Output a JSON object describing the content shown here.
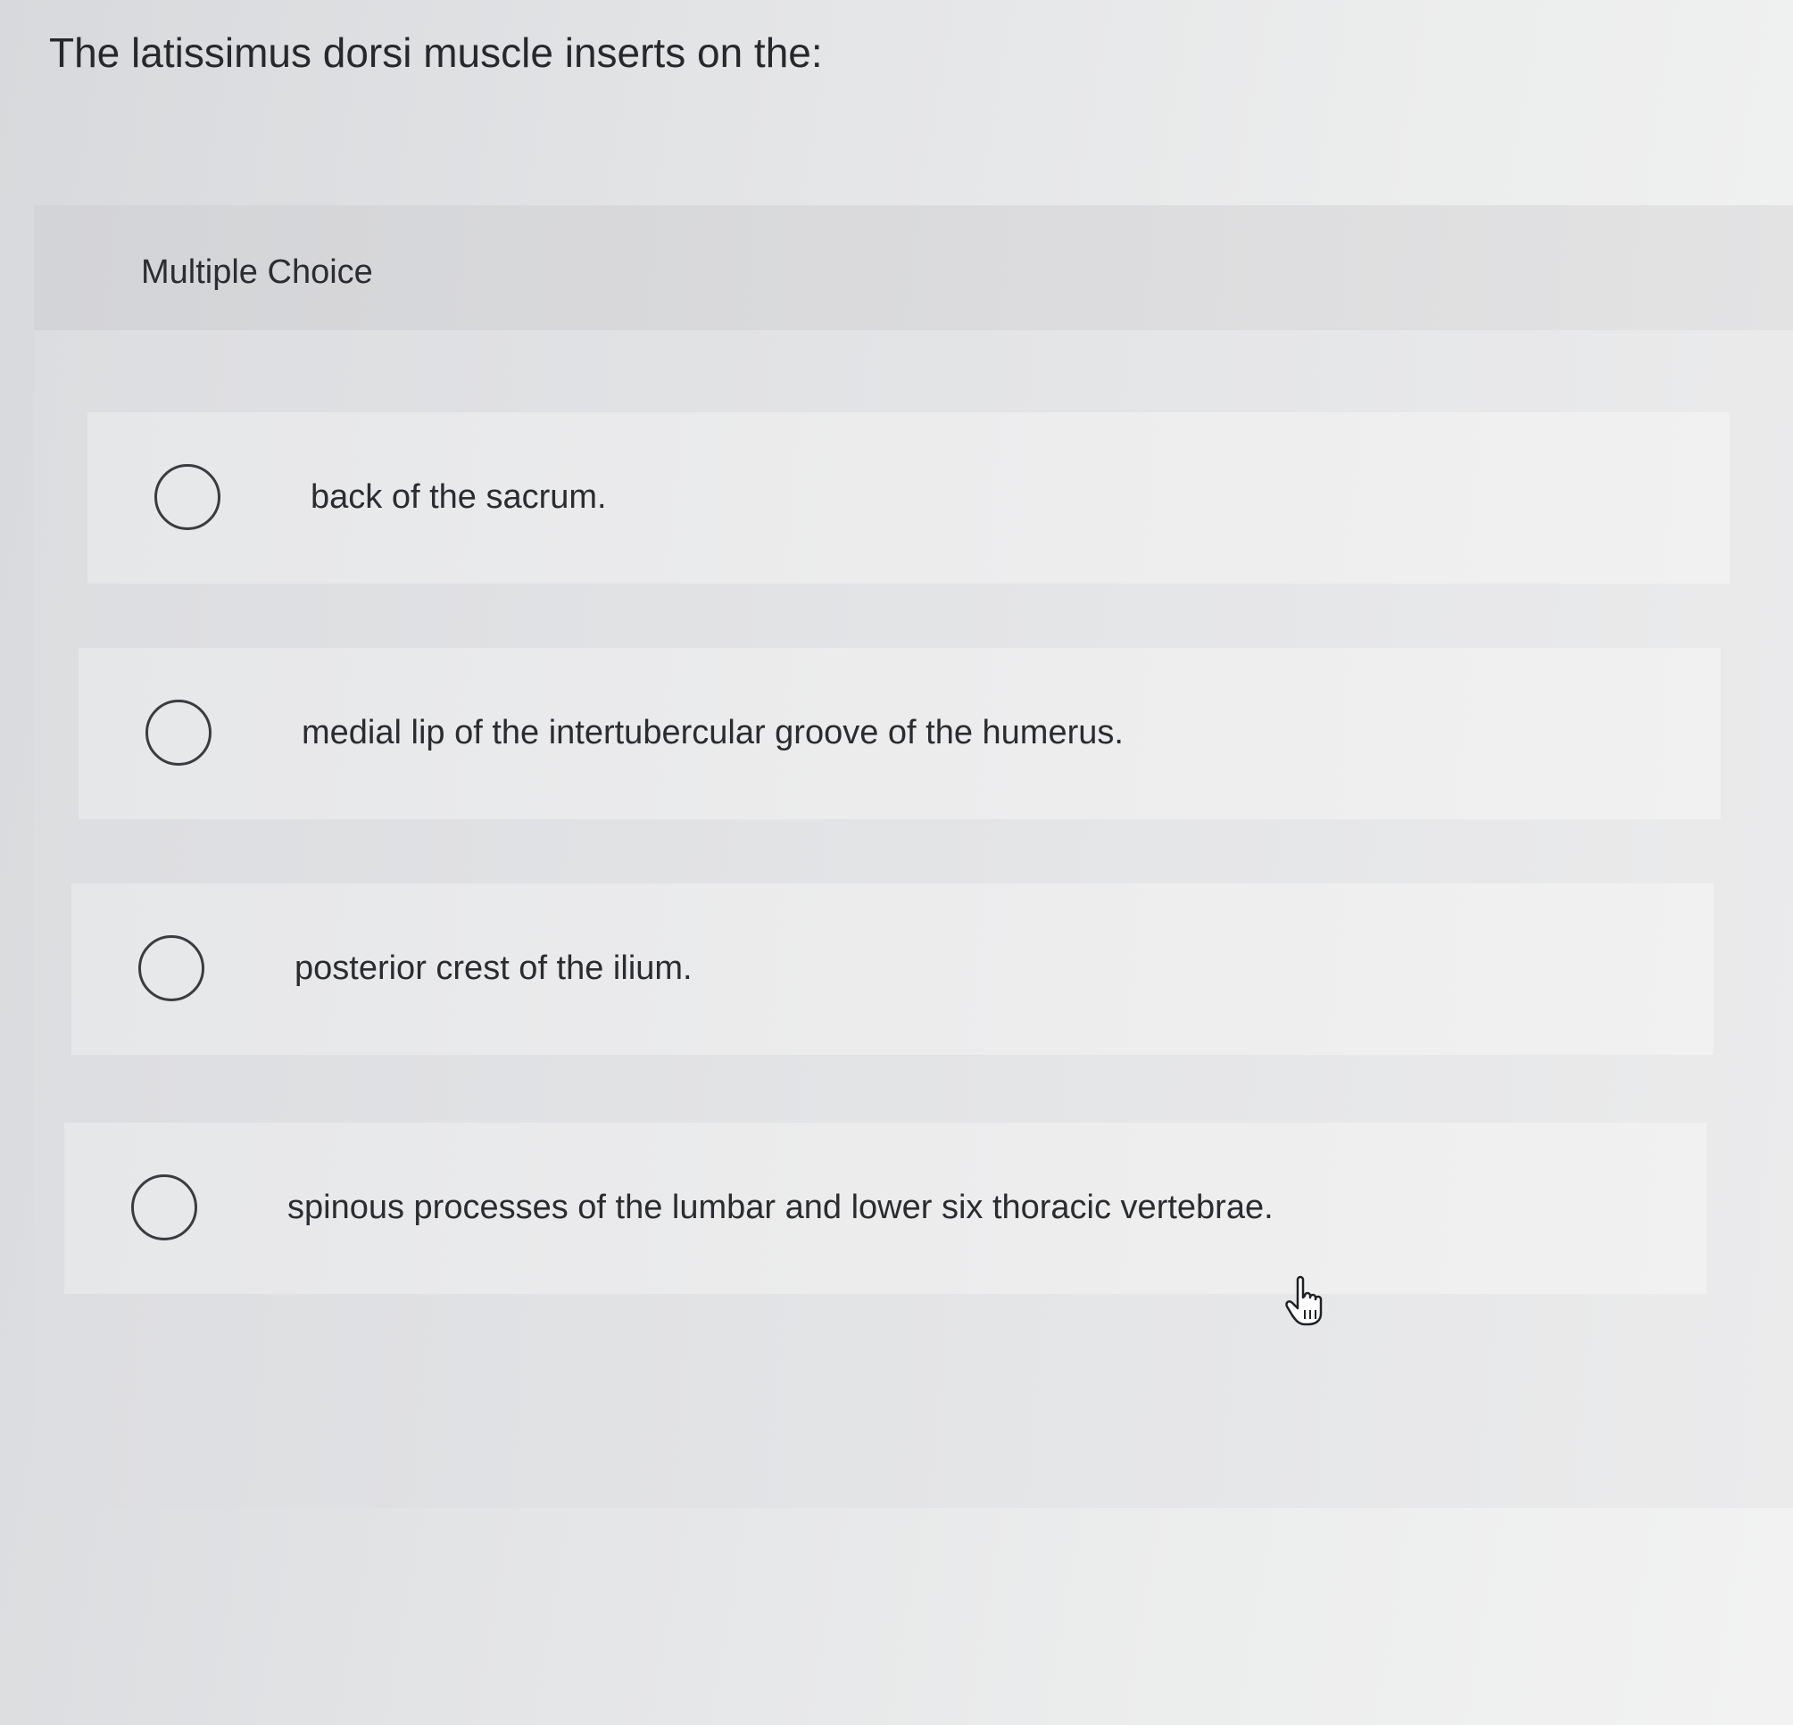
{
  "question": {
    "text": "The latissimus dorsi muscle inserts on the:"
  },
  "multiple_choice": {
    "label": "Multiple Choice",
    "options": [
      {
        "label": "back of the sacrum."
      },
      {
        "label": "medial lip of the intertubercular groove of the humerus."
      },
      {
        "label": "posterior crest of the ilium."
      },
      {
        "label": "spinous processes of the lumbar and lower six thoracic vertebrae."
      }
    ]
  },
  "cursor": {
    "icon": "hand-pointer-icon"
  },
  "colors": {
    "background": "#e3e4e6",
    "text": "#2a2c2f",
    "radio_border": "#3a3c3f"
  }
}
